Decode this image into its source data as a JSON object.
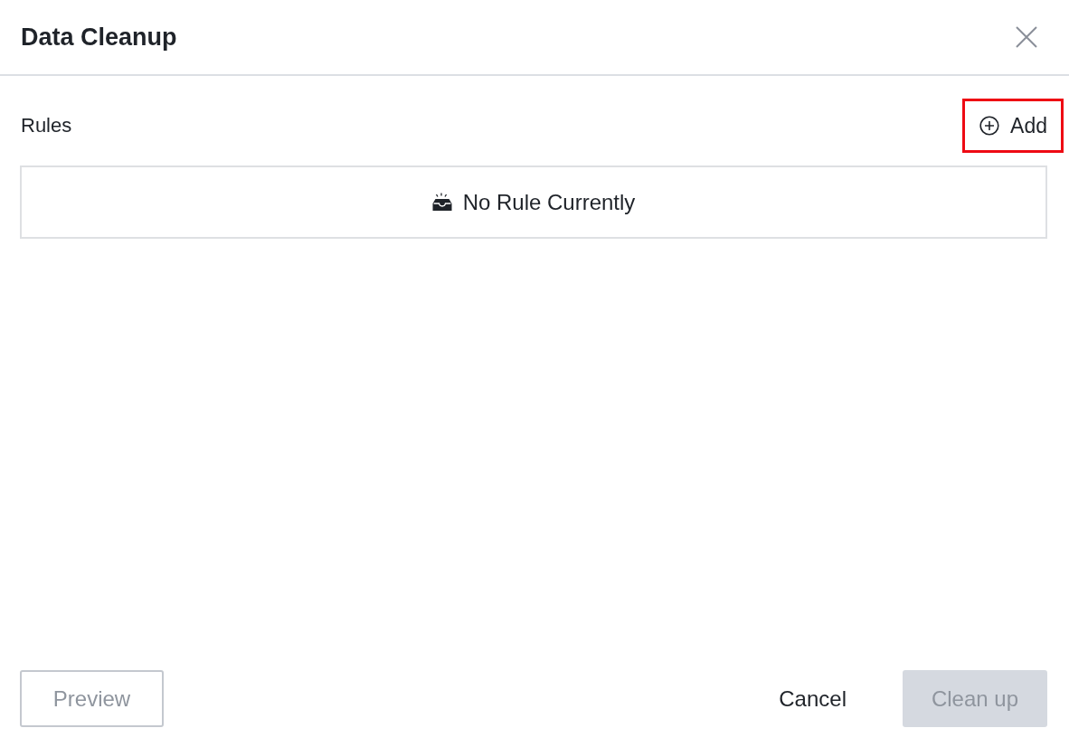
{
  "dialog": {
    "title": "Data Cleanup"
  },
  "rules": {
    "label": "Rules",
    "add_button": {
      "label": "Add",
      "highlighted": true
    },
    "empty_state": {
      "message": "No Rule Currently"
    }
  },
  "footer": {
    "left": [
      {
        "label": "Preview",
        "kind": "outline",
        "disabled": true
      }
    ],
    "right": [
      {
        "label": "Cancel",
        "kind": "text",
        "disabled": false
      },
      {
        "label": "Clean up",
        "kind": "primary",
        "disabled": true
      }
    ]
  }
}
